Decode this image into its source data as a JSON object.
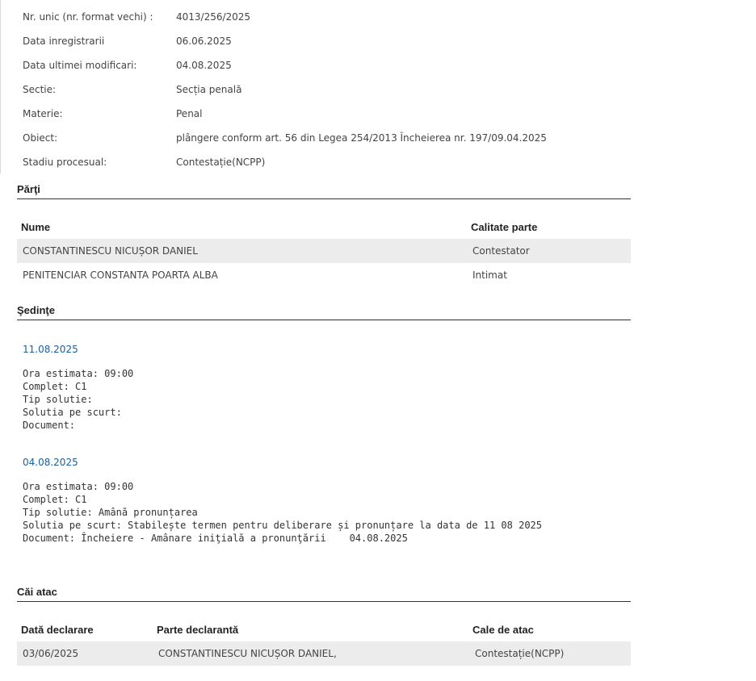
{
  "details": [
    {
      "label": "Nr. unic (nr. format vechi) :",
      "value": "4013/256/2025"
    },
    {
      "label": "Data inregistrarii",
      "value": "06.06.2025"
    },
    {
      "label": "Data ultimei modificari:",
      "value": "04.08.2025"
    },
    {
      "label": "Sectie:",
      "value": "Secția penală"
    },
    {
      "label": "Materie:",
      "value": "Penal"
    },
    {
      "label": "Obiect:",
      "value": "plângere conform art. 56 din Legea 254/2013 Încheierea nr. 197/09.04.2025"
    },
    {
      "label": "Stadiu procesual:",
      "value": "Contestație(NCPP)"
    }
  ],
  "parti": {
    "title": "Părţi",
    "headers": {
      "nume": "Nume",
      "calitate": "Calitate parte"
    },
    "rows": [
      {
        "nume": "CONSTANTINESCU NICUȘOR DANIEL",
        "calitate": "Contestator"
      },
      {
        "nume": "PENITENCIAR CONSTANTA POARTA ALBA",
        "calitate": "Intimat"
      }
    ]
  },
  "sedinte": {
    "title": "Şedinţe",
    "items": [
      {
        "date": "11.08.2025",
        "ora": "Ora estimata: 09:00",
        "complet": "Complet: C1",
        "tip": "Tip solutie:",
        "solutia": "Solutia pe scurt:",
        "document": "Document:"
      },
      {
        "date": "04.08.2025",
        "ora": "Ora estimata: 09:00",
        "complet": "Complet: C1",
        "tip": "Tip solutie: Amână pronunțarea",
        "solutia": "Solutia pe scurt: Stabilește termen pentru deliberare și pronunțare la data de 11 08 2025",
        "document": "Document: Încheiere - Amânare iniţială a pronunţării    04.08.2025"
      }
    ]
  },
  "cai_atac": {
    "title": "Căi atac",
    "headers": {
      "data": "Dată declarare",
      "parte": "Parte declarantă",
      "cale": "Cale de atac"
    },
    "rows": [
      {
        "data": "03/06/2025",
        "parte": "CONSTANTINESCU NICUȘOR DANIEL,",
        "cale": "Contestație(NCPP)"
      }
    ]
  },
  "colors": {
    "link": "#1a5f9e",
    "row_shade": "#ececec",
    "rule": "#333333"
  }
}
